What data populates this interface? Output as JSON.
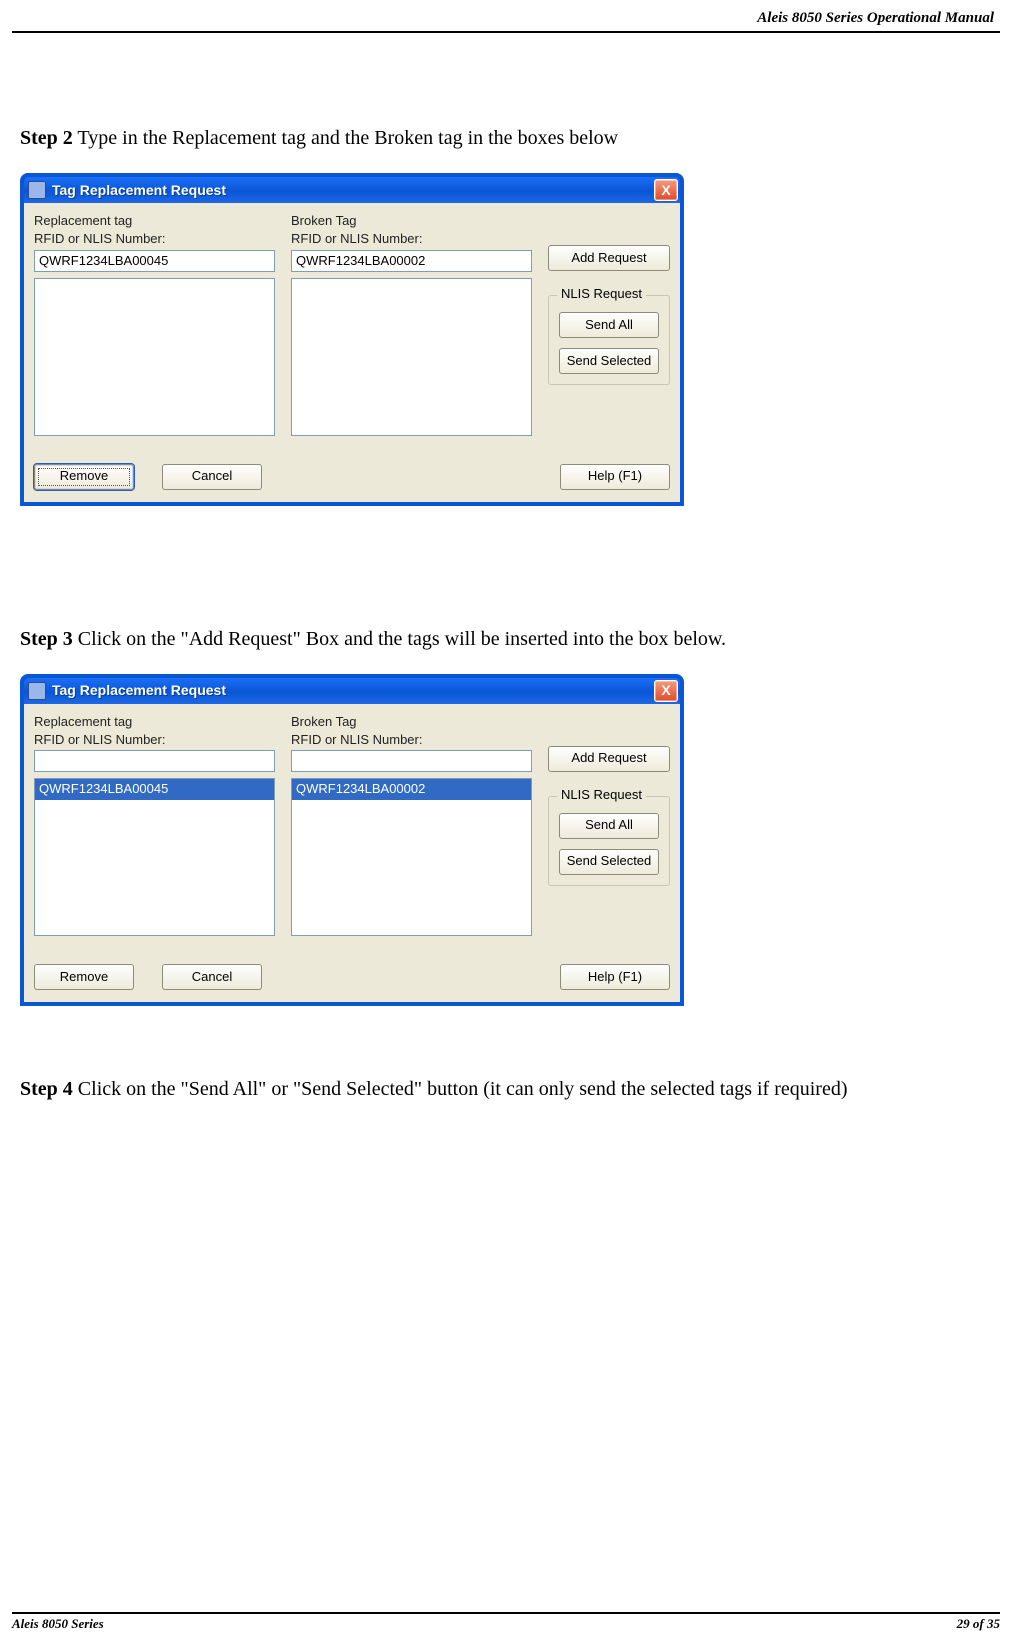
{
  "header_right": "Aleis 8050 Series Operational Manual",
  "step2": {
    "bold": "Step 2",
    "text": " Type in the Replacement tag and the Broken tag in the boxes below"
  },
  "step3": {
    "bold": "Step 3",
    "text": " Click on the \"Add Request\" Box and the tags will be inserted into the box below."
  },
  "step4": {
    "bold": "Step 4",
    "text": " Click on the \"Send All\" or \"Send Selected\" button (it can only send the selected tags if required)"
  },
  "dialog": {
    "title": "Tag Replacement Request",
    "close_x": "X",
    "replacement_lbl1": "Replacement tag",
    "replacement_lbl2": "RFID or NLIS Number:",
    "broken_lbl1": "Broken Tag",
    "broken_lbl2": "RFID or NLIS Number:",
    "add_request": "Add Request",
    "group_legend": "NLIS Request",
    "send_all": "Send All",
    "send_selected": "Send Selected",
    "remove": "Remove",
    "cancel": "Cancel",
    "help": "Help (F1)"
  },
  "screenshot1": {
    "replacement_value": "QWRF1234LBA00045",
    "broken_value": "QWRF1234LBA00002",
    "replacement_list": [],
    "broken_list": []
  },
  "screenshot2": {
    "replacement_value": "",
    "broken_value": "",
    "replacement_list": [
      "QWRF1234LBA00045"
    ],
    "broken_list": [
      "QWRF1234LBA00002"
    ]
  },
  "footer_left": "Aleis 8050 Series",
  "footer_right": "29 of 35"
}
